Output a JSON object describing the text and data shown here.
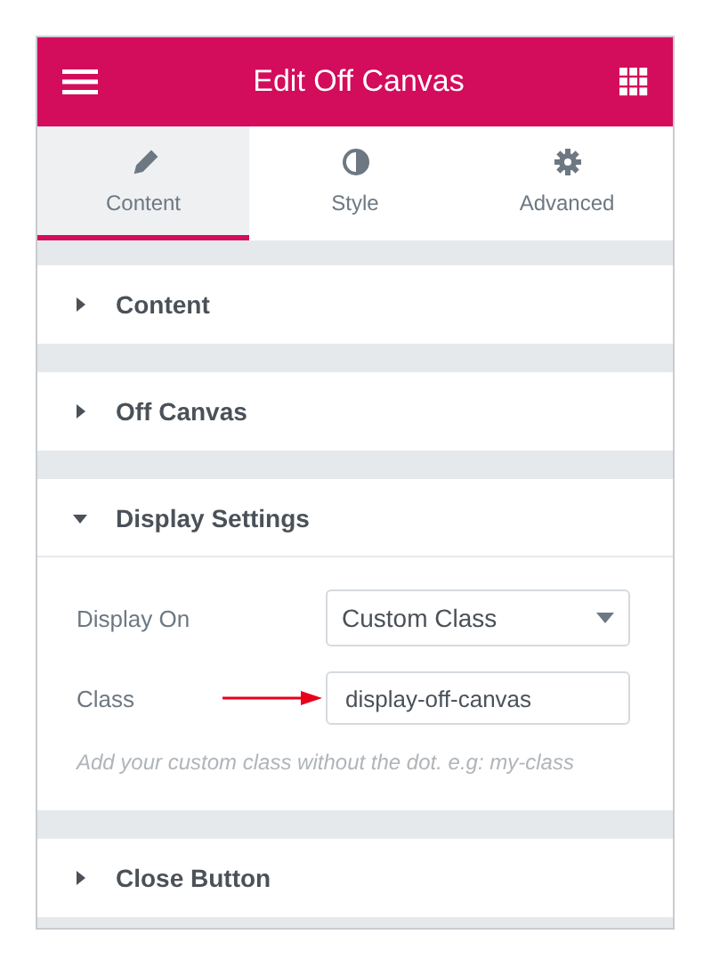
{
  "header": {
    "title": "Edit Off Canvas"
  },
  "tabs": [
    {
      "label": "Content",
      "selected": true
    },
    {
      "label": "Style",
      "selected": false
    },
    {
      "label": "Advanced",
      "selected": false
    }
  ],
  "sections": [
    {
      "title": "Content",
      "expanded": false
    },
    {
      "title": "Off Canvas",
      "expanded": false
    },
    {
      "title": "Display Settings",
      "expanded": true,
      "fields": [
        {
          "kind": "select",
          "label": "Display On",
          "value": "Custom Class"
        },
        {
          "kind": "text",
          "label": "Class",
          "value": "display-off-canvas",
          "pointer": true
        }
      ],
      "hint": "Add your custom class without the dot. e.g: my-class"
    },
    {
      "title": "Close Button",
      "expanded": false
    }
  ]
}
